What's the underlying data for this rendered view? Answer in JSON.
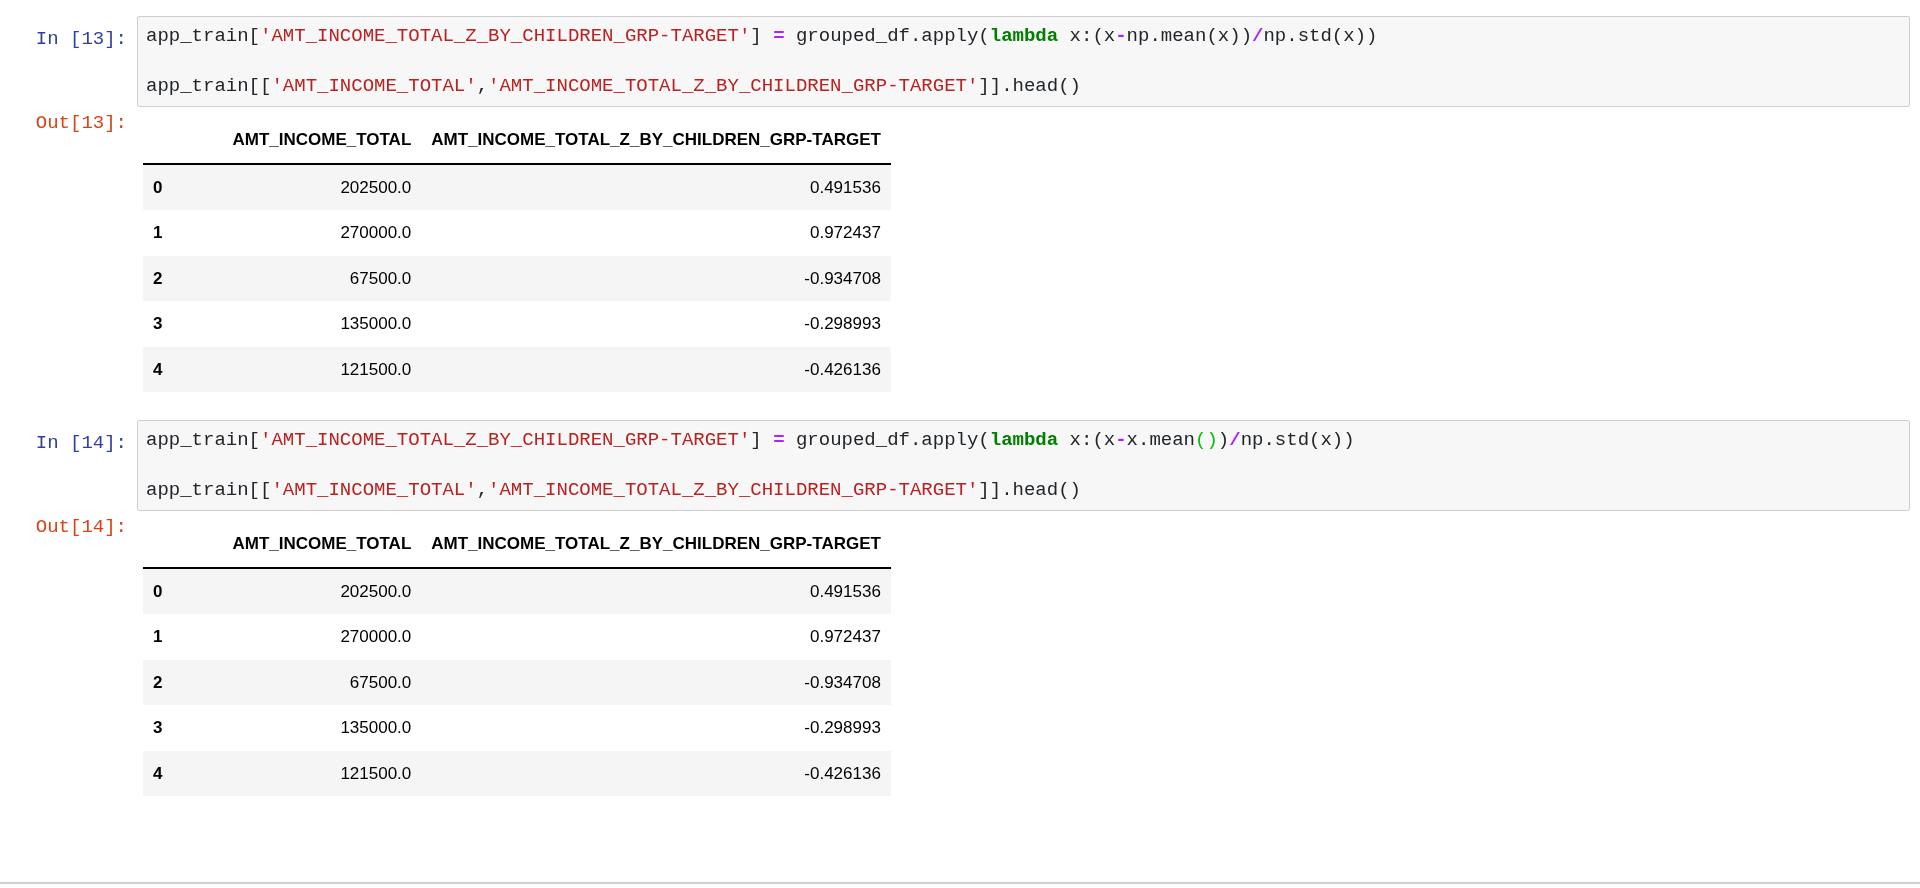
{
  "cells": [
    {
      "input_prompt": "In [13]:",
      "code_lines": [
        [
          {
            "kind": "name",
            "text": "app_train["
          },
          {
            "kind": "str",
            "text": "'AMT_INCOME_TOTAL_Z_BY_CHILDREN_GRP-TARGET'"
          },
          {
            "kind": "name",
            "text": "] "
          },
          {
            "kind": "op",
            "text": "="
          },
          {
            "kind": "name",
            "text": " grouped_df.apply("
          },
          {
            "kind": "kw",
            "text": "lambda"
          },
          {
            "kind": "name",
            "text": " x:(x"
          },
          {
            "kind": "op",
            "text": "-"
          },
          {
            "kind": "name",
            "text": "np.mean(x))"
          },
          {
            "kind": "op",
            "text": "/"
          },
          {
            "kind": "name",
            "text": "np.std(x))"
          }
        ],
        [
          {
            "kind": "name",
            "text": "app_train[["
          },
          {
            "kind": "str",
            "text": "'AMT_INCOME_TOTAL'"
          },
          {
            "kind": "name",
            "text": ","
          },
          {
            "kind": "str",
            "text": "'AMT_INCOME_TOTAL_Z_BY_CHILDREN_GRP-TARGET'"
          },
          {
            "kind": "name",
            "text": "]].head()"
          }
        ]
      ],
      "output_prompt": "Out[13]:",
      "table": {
        "columns": [
          "AMT_INCOME_TOTAL",
          "AMT_INCOME_TOTAL_Z_BY_CHILDREN_GRP-TARGET"
        ],
        "rows": [
          {
            "index": "0",
            "values": [
              "202500.0",
              "0.491536"
            ]
          },
          {
            "index": "1",
            "values": [
              "270000.0",
              "0.972437"
            ]
          },
          {
            "index": "2",
            "values": [
              "67500.0",
              "-0.934708"
            ]
          },
          {
            "index": "3",
            "values": [
              "135000.0",
              "-0.298993"
            ]
          },
          {
            "index": "4",
            "values": [
              "121500.0",
              "-0.426136"
            ]
          }
        ]
      }
    },
    {
      "input_prompt": "In [14]:",
      "code_lines": [
        [
          {
            "kind": "name",
            "text": "app_train["
          },
          {
            "kind": "str",
            "text": "'AMT_INCOME_TOTAL_Z_BY_CHILDREN_GRP-TARGET'"
          },
          {
            "kind": "name",
            "text": "] "
          },
          {
            "kind": "op",
            "text": "="
          },
          {
            "kind": "name",
            "text": " grouped_df.apply("
          },
          {
            "kind": "kw",
            "text": "lambda"
          },
          {
            "kind": "name",
            "text": " x:(x"
          },
          {
            "kind": "op",
            "text": "-"
          },
          {
            "kind": "name",
            "text": "x.mean"
          },
          {
            "kind": "match",
            "text": "()"
          },
          {
            "kind": "name",
            "text": ")"
          },
          {
            "kind": "op",
            "text": "/"
          },
          {
            "kind": "name",
            "text": "np.std(x))"
          }
        ],
        [
          {
            "kind": "name",
            "text": "app_train[["
          },
          {
            "kind": "str",
            "text": "'AMT_INCOME_TOTAL'"
          },
          {
            "kind": "name",
            "text": ","
          },
          {
            "kind": "str",
            "text": "'AMT_INCOME_TOTAL_Z_BY_CHILDREN_GRP-TARGET'"
          },
          {
            "kind": "name",
            "text": "]].head()"
          }
        ]
      ],
      "output_prompt": "Out[14]:",
      "table": {
        "columns": [
          "AMT_INCOME_TOTAL",
          "AMT_INCOME_TOTAL_Z_BY_CHILDREN_GRP-TARGET"
        ],
        "rows": [
          {
            "index": "0",
            "values": [
              "202500.0",
              "0.491536"
            ]
          },
          {
            "index": "1",
            "values": [
              "270000.0",
              "0.972437"
            ]
          },
          {
            "index": "2",
            "values": [
              "67500.0",
              "-0.934708"
            ]
          },
          {
            "index": "3",
            "values": [
              "135000.0",
              "-0.298993"
            ]
          },
          {
            "index": "4",
            "values": [
              "121500.0",
              "-0.426136"
            ]
          }
        ]
      }
    }
  ]
}
